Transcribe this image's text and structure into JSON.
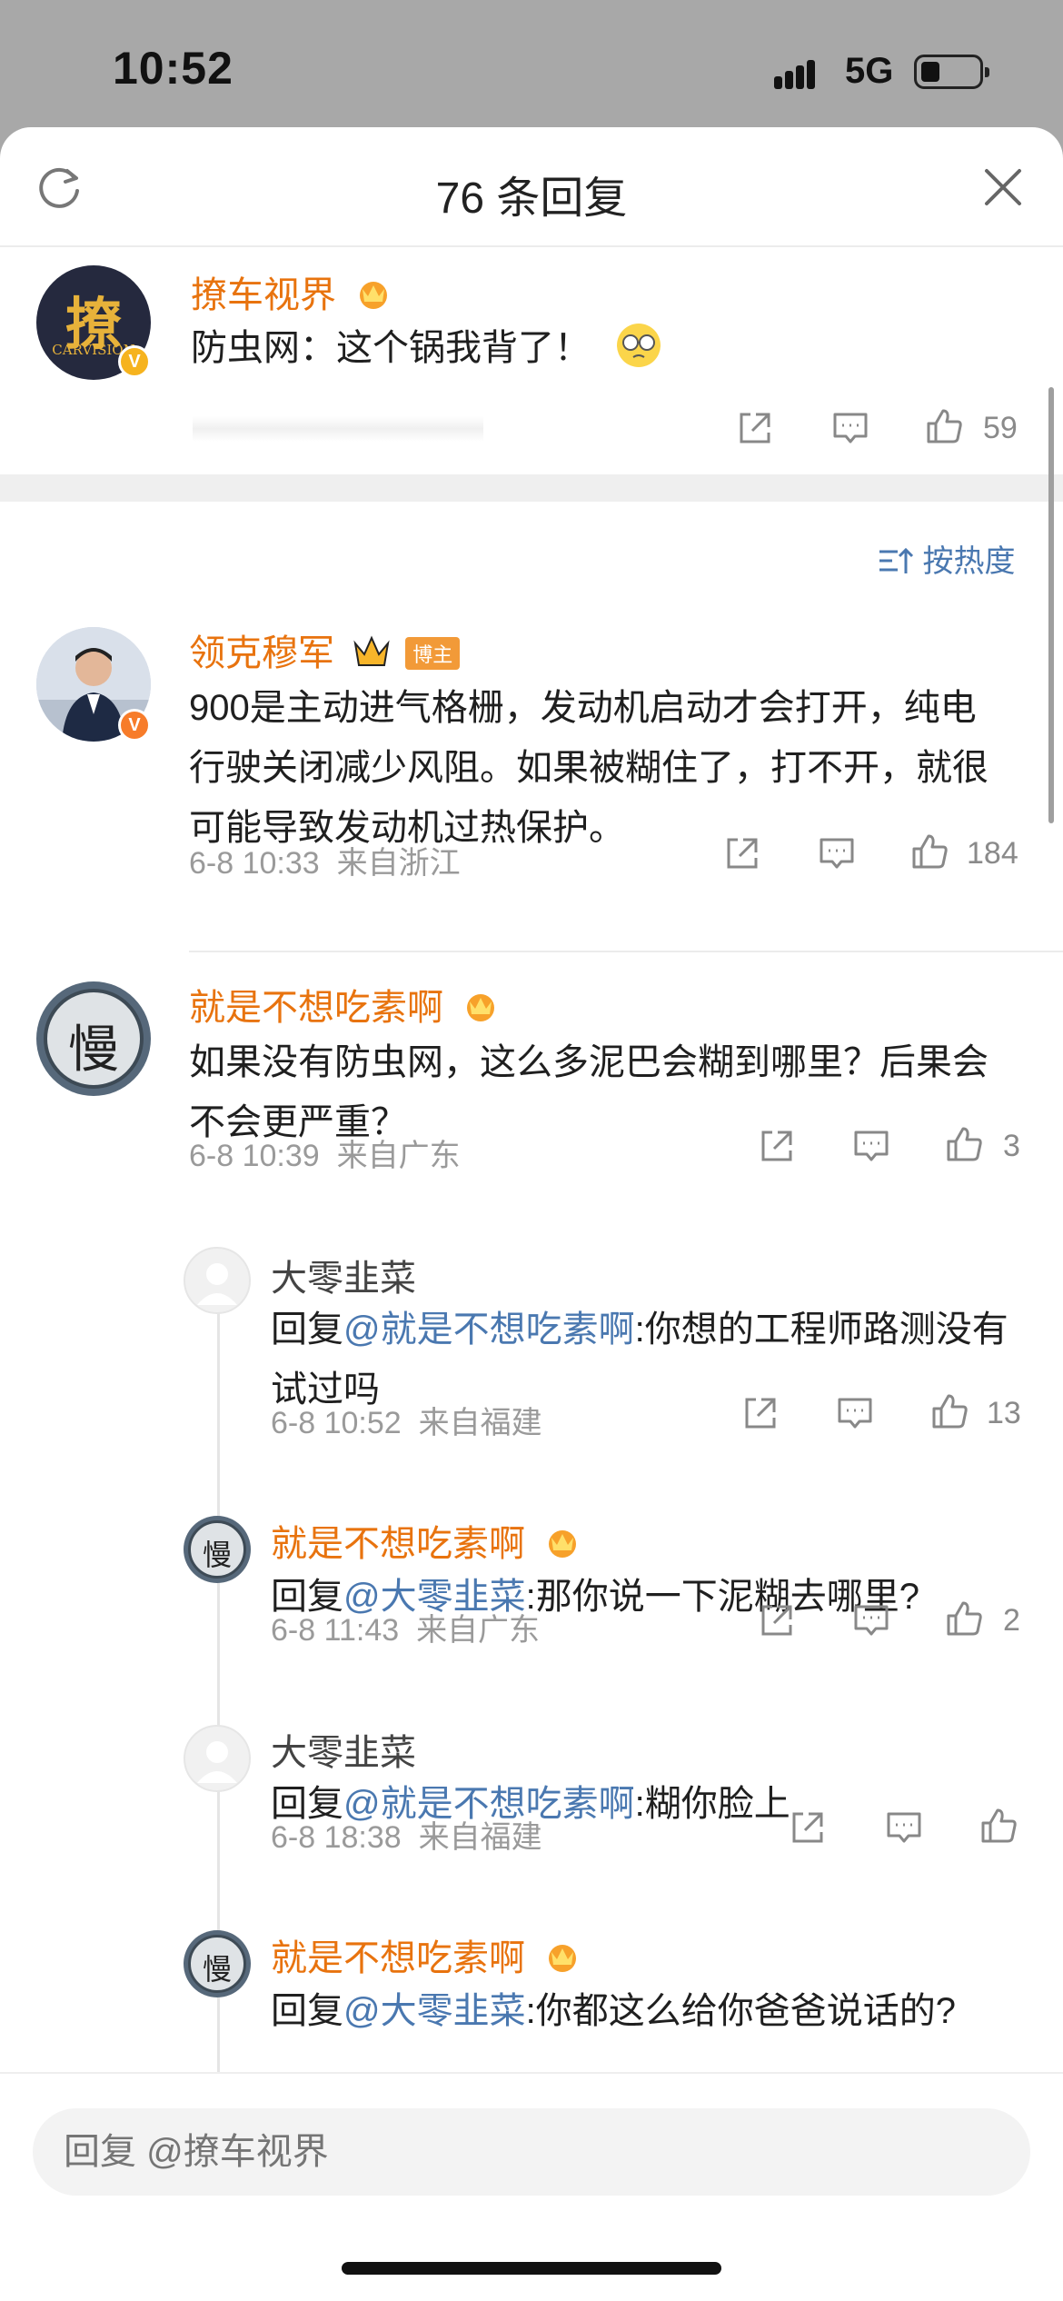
{
  "status": {
    "time": "10:52",
    "network": "5G"
  },
  "header": {
    "title": "76 条回复"
  },
  "root_comment": {
    "author": "撩车视界",
    "avatar_text": "撩",
    "avatar_sub": "CARVISION",
    "text": "防虫网：这个锅我背了！",
    "likes": "59"
  },
  "sort": {
    "label": "按热度"
  },
  "replies": [
    {
      "author": "领克穆军",
      "badge": "博主",
      "text": "900是主动进气格栅，发动机启动才会打开，纯电行驶关闭减少风阻。如果被糊住了，打不开，就很可能导致发动机过热保护。",
      "time": "6-8 10:33",
      "location": "来自浙江",
      "likes": "184"
    },
    {
      "author": "就是不想吃素啊",
      "text": "如果没有防虫网，这么多泥巴会糊到哪里？后果会不会更严重？",
      "time": "6-8 10:39",
      "location": "来自广东",
      "likes": "3",
      "avatar_text": "慢"
    }
  ],
  "subreplies": [
    {
      "author": "大零韭菜",
      "prefix": "回复",
      "mention": "@就是不想吃素啊",
      "text": ":你想的工程师路测没有试过吗",
      "time": "6-8 10:52",
      "location": "来自福建",
      "likes": "13"
    },
    {
      "author": "就是不想吃素啊",
      "prefix": "回复",
      "mention": "@大零韭菜",
      "text": ":那你说一下泥糊去哪里?",
      "time": "6-8 11:43",
      "location": "来自广东",
      "likes": "2"
    },
    {
      "author": "大零韭菜",
      "prefix": "回复",
      "mention": "@就是不想吃素啊",
      "text": ":糊你脸上",
      "time": "6-8 18:38",
      "location": "来自福建",
      "likes": ""
    },
    {
      "author": "就是不想吃素啊",
      "prefix": "回复",
      "mention": "@大零韭菜",
      "text": ":你都这么给你爸爸说话的?",
      "time": "",
      "location": "",
      "likes": ""
    }
  ],
  "reply_box": {
    "placeholder": "回复 @撩车视界"
  },
  "colors": {
    "accent_orange": "#e8730e",
    "link_blue": "#4a78b0",
    "meta_gray": "#9a9a9a"
  }
}
